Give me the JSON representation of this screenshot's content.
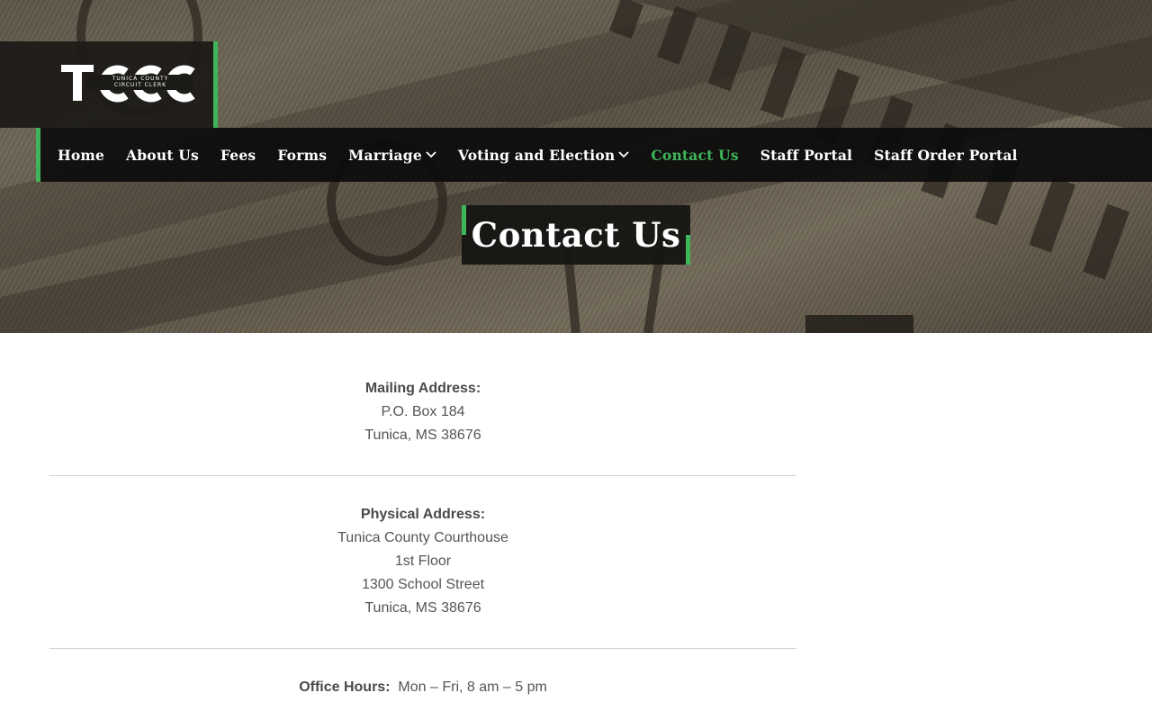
{
  "brand": {
    "logo_letters": "TCCC",
    "logo_subtitle_line1": "TUNICA COUNTY",
    "logo_subtitle_line2": "CIRCUIT CLERK",
    "accent_color": "#3fb55a"
  },
  "nav": {
    "items": [
      {
        "label": "Home",
        "active": false,
        "has_dropdown": false
      },
      {
        "label": "About Us",
        "active": false,
        "has_dropdown": false
      },
      {
        "label": "Fees",
        "active": false,
        "has_dropdown": false
      },
      {
        "label": "Forms",
        "active": false,
        "has_dropdown": false
      },
      {
        "label": "Marriage",
        "active": false,
        "has_dropdown": true
      },
      {
        "label": "Voting and Election",
        "active": false,
        "has_dropdown": true
      },
      {
        "label": "Contact Us",
        "active": true,
        "has_dropdown": false
      },
      {
        "label": "Staff Portal",
        "active": false,
        "has_dropdown": false
      },
      {
        "label": "Staff Order Portal",
        "active": false,
        "has_dropdown": false
      }
    ]
  },
  "page": {
    "title": "Contact Us"
  },
  "contact": {
    "mailing": {
      "label": "Mailing Address:",
      "lines": [
        "P.O. Box 184",
        "Tunica, MS 38676"
      ]
    },
    "physical": {
      "label": "Physical Address:",
      "lines": [
        "Tunica County Courthouse",
        "1st Floor",
        "1300 School Street",
        "Tunica, MS 38676"
      ]
    },
    "hours": {
      "label": "Office Hours:",
      "value": "Mon – Fri, 8 am – 5 pm"
    }
  }
}
